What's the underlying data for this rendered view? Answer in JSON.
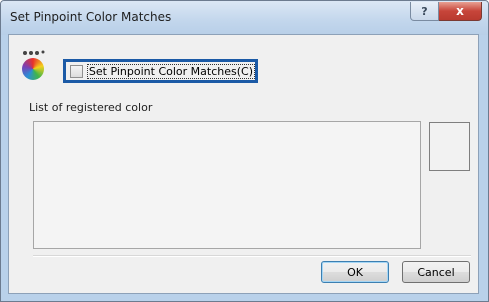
{
  "window": {
    "title": "Set Pinpoint Color Matches",
    "help_label": "?",
    "close_label": "x"
  },
  "icons": {
    "palette": "color-palette-icon",
    "dots": "ꔷꔷꔷ"
  },
  "checkbox": {
    "label": "Set Pinpoint Color Matches(C)",
    "checked": false
  },
  "list": {
    "label": "List of registered color",
    "items": []
  },
  "buttons": {
    "ok_label": "OK",
    "cancel_label": "Cancel"
  },
  "colors": {
    "focus_border": "#1b5aa6",
    "title_bar": "#c2d6ec",
    "close_button": "#c7453a"
  }
}
